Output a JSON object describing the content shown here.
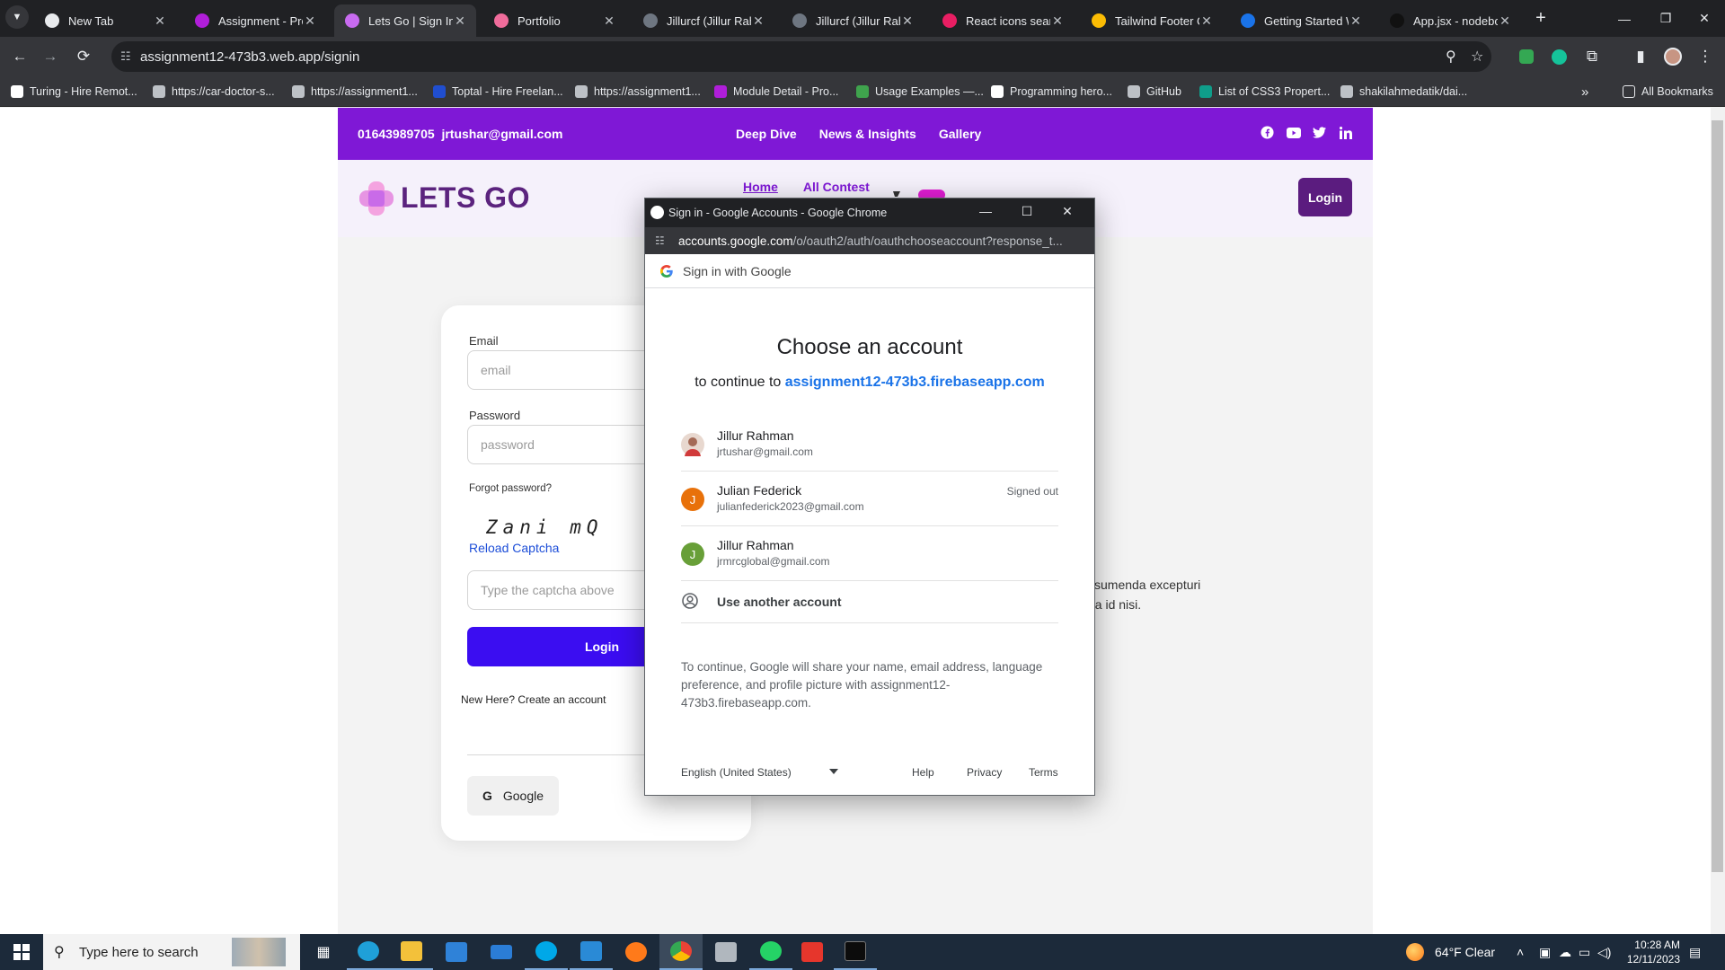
{
  "browser": {
    "tabs": [
      {
        "label": "New Tab",
        "color": "#e8eaed"
      },
      {
        "label": "Assignment - Pro",
        "color": "#b01ed9"
      },
      {
        "label": "Lets Go | Sign In",
        "color": "#c86bf0"
      },
      {
        "label": "Portfolio",
        "color": "#f06c9b"
      },
      {
        "label": "Jillurcf (Jillur Rahm",
        "color": "#6e7681"
      },
      {
        "label": "Jillurcf (Jillur Rahm",
        "color": "#6e7681"
      },
      {
        "label": "React icons search",
        "color": "#e91e63"
      },
      {
        "label": "Tailwind Footer Co",
        "color": "#fbbc04"
      },
      {
        "label": "Getting Started W",
        "color": "#1a73e8"
      },
      {
        "label": "App.jsx - nodebox",
        "color": "#111111"
      }
    ],
    "url": "assignment12-473b3.web.app/signin",
    "bookmarks": [
      {
        "label": "Turing - Hire Remot...",
        "color": "#ffffff"
      },
      {
        "label": "https://car-doctor-s...",
        "color": "#bdc1c6"
      },
      {
        "label": "https://assignment1...",
        "color": "#bdc1c6"
      },
      {
        "label": "Toptal - Hire Freelan...",
        "color": "#204ecf"
      },
      {
        "label": "https://assignment1...",
        "color": "#bdc1c6"
      },
      {
        "label": "Module Detail - Pro...",
        "color": "#b01ed9"
      },
      {
        "label": "Usage Examples —...",
        "color": "#3fa34d"
      },
      {
        "label": "Programming hero...",
        "color": "#ffffff"
      },
      {
        "label": "GitHub",
        "color": "#bdc1c6"
      },
      {
        "label": "List of CSS3 Propert...",
        "color": "#0f9d8a"
      },
      {
        "label": "shakilahmedatik/dai...",
        "color": "#bdc1c6"
      }
    ],
    "all_bookmarks": "All Bookmarks"
  },
  "site": {
    "phone": "01643989705",
    "email": "jrtushar@gmail.com",
    "top_nav": [
      "Deep Dive",
      "News & Insights",
      "Gallery"
    ],
    "social_icons": [
      "facebook-icon",
      "youtube-icon",
      "twitter-icon",
      "linkedin-icon"
    ],
    "logo_text": "LETS GO",
    "main_nav": [
      "Home",
      "All Contest"
    ],
    "login_label": "Login",
    "brand_color": "#7f18d6"
  },
  "login_form": {
    "email_label": "Email",
    "email_placeholder": "email",
    "password_label": "Password",
    "password_placeholder": "password",
    "forgot": "Forgot password?",
    "captcha": "Zani mQ",
    "reload": "Reload Captcha",
    "captcha_placeholder": "Type the captcha above",
    "submit": "Login",
    "new_here": "New Here? Create an account",
    "google": "Google"
  },
  "page_text": {
    "line1": "ssumenda excepturi",
    "line2": "t a id nisi."
  },
  "popup": {
    "window_title": "Sign in - Google Accounts - Google Chrome",
    "url_host": "accounts.google.com",
    "url_path": "/o/oauth2/auth/oauthchooseaccount?response_t...",
    "signin_with": "Sign in with Google",
    "title": "Choose an account",
    "continue_prefix": "to continue to",
    "continue_app": "assignment12-473b3.firebaseapp.com",
    "accounts": [
      {
        "name": "Jillur Rahman",
        "email": "jrtushar@gmail.com",
        "status": "",
        "initial": "",
        "color": "#d9b3a4"
      },
      {
        "name": "Julian Federick",
        "email": "julianfederick2023@gmail.com",
        "status": "Signed out",
        "initial": "J",
        "color": "#e8710a"
      },
      {
        "name": "Jillur Rahman",
        "email": "jrmrcglobal@gmail.com",
        "status": "",
        "initial": "J",
        "color": "#689f38"
      }
    ],
    "use_another": "Use another account",
    "disclaimer": "To continue, Google will share your name, email address, language preference, and profile picture with assignment12-473b3.firebaseapp.com.",
    "language": "English (United States)",
    "footer_links": [
      "Help",
      "Privacy",
      "Terms"
    ]
  },
  "taskbar": {
    "search_placeholder": "Type here to search",
    "weather": "64°F  Clear",
    "time": "10:28 AM",
    "date": "12/11/2023"
  }
}
